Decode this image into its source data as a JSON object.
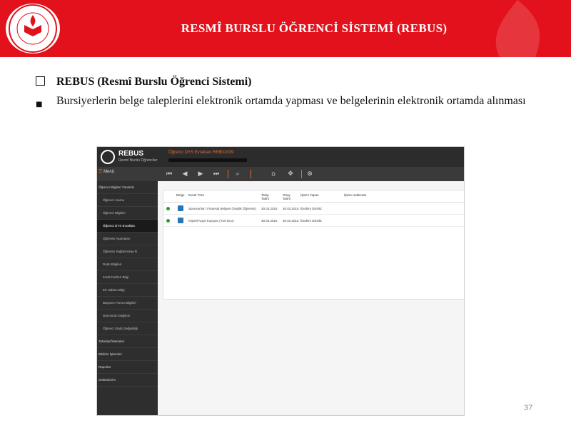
{
  "header": {
    "title": "RESMÎ BURSLU ÖĞRENCİ SİSTEMİ (REBUS)",
    "logo_text": "T.C. MİLLÎ EĞİTİM BAKANLIĞI"
  },
  "bullets": [
    {
      "marker": "square",
      "text": "REBUS (Resmî Burslu Öğrenci Sistemi)"
    },
    {
      "marker": "small",
      "text": "Bursiyerlerin belge taleplerini elektronik ortamda yapması ve belgelerinin elektronik ortamda alınması"
    }
  ],
  "app": {
    "logo_text": "REBUS",
    "logo_sub": "Resmî Burslu Öğrenciler",
    "window_title": "Öğrenci DYS Evrakları REB01009",
    "menu_label": "Menü",
    "sidebar": [
      {
        "label": "Öğrenci Bilgileri Yönetimi"
      },
      {
        "label": "Öğrenci Arama"
      },
      {
        "label": "Öğrenci Bilgileri"
      },
      {
        "label": "Öğrenci DYS Evrakları"
      },
      {
        "label": "Öğrenim Aşamaları"
      },
      {
        "label": "Öğrenim Sağlık/Ateşe İli"
      },
      {
        "label": "Rutin Bilgileri"
      },
      {
        "label": "Kredi Faizleri Bilgi"
      },
      {
        "label": "Ek Hakları Bilgi"
      },
      {
        "label": "Başvuru Formu Bilgileri"
      },
      {
        "label": "Danışman Dağılımı"
      },
      {
        "label": "Öğrenci Statü Değişikliği"
      },
      {
        "label": "Tahsilat/Ödemeler"
      },
      {
        "label": "Bildirim İşlemleri"
      },
      {
        "label": "Raporlar"
      },
      {
        "label": "Dökümlerim"
      }
    ],
    "table": {
      "headers": [
        "Belge",
        "Evrak Türü",
        "Talep Tarihi",
        "Onay Tarihi",
        "İşlemi Yapan",
        "İşlem Hakkında"
      ],
      "rows": [
        {
          "type": "Sponsorluk / Finansal Belgesi (Tasdik Öğrenim)",
          "requested": "30.03.2015",
          "approved": "30.03.2015",
          "by": "İbrahim DENİZ"
        },
        {
          "type": "Kişisel Kayıt Kopyası (Yurt Dışı)",
          "requested": "30.03.2015",
          "approved": "30.03.2015",
          "by": "İbrahim DENİZ"
        }
      ]
    }
  },
  "page_number": "37",
  "colors": {
    "header_red": "#e3111b",
    "accent_orange": "#e46a2a"
  }
}
